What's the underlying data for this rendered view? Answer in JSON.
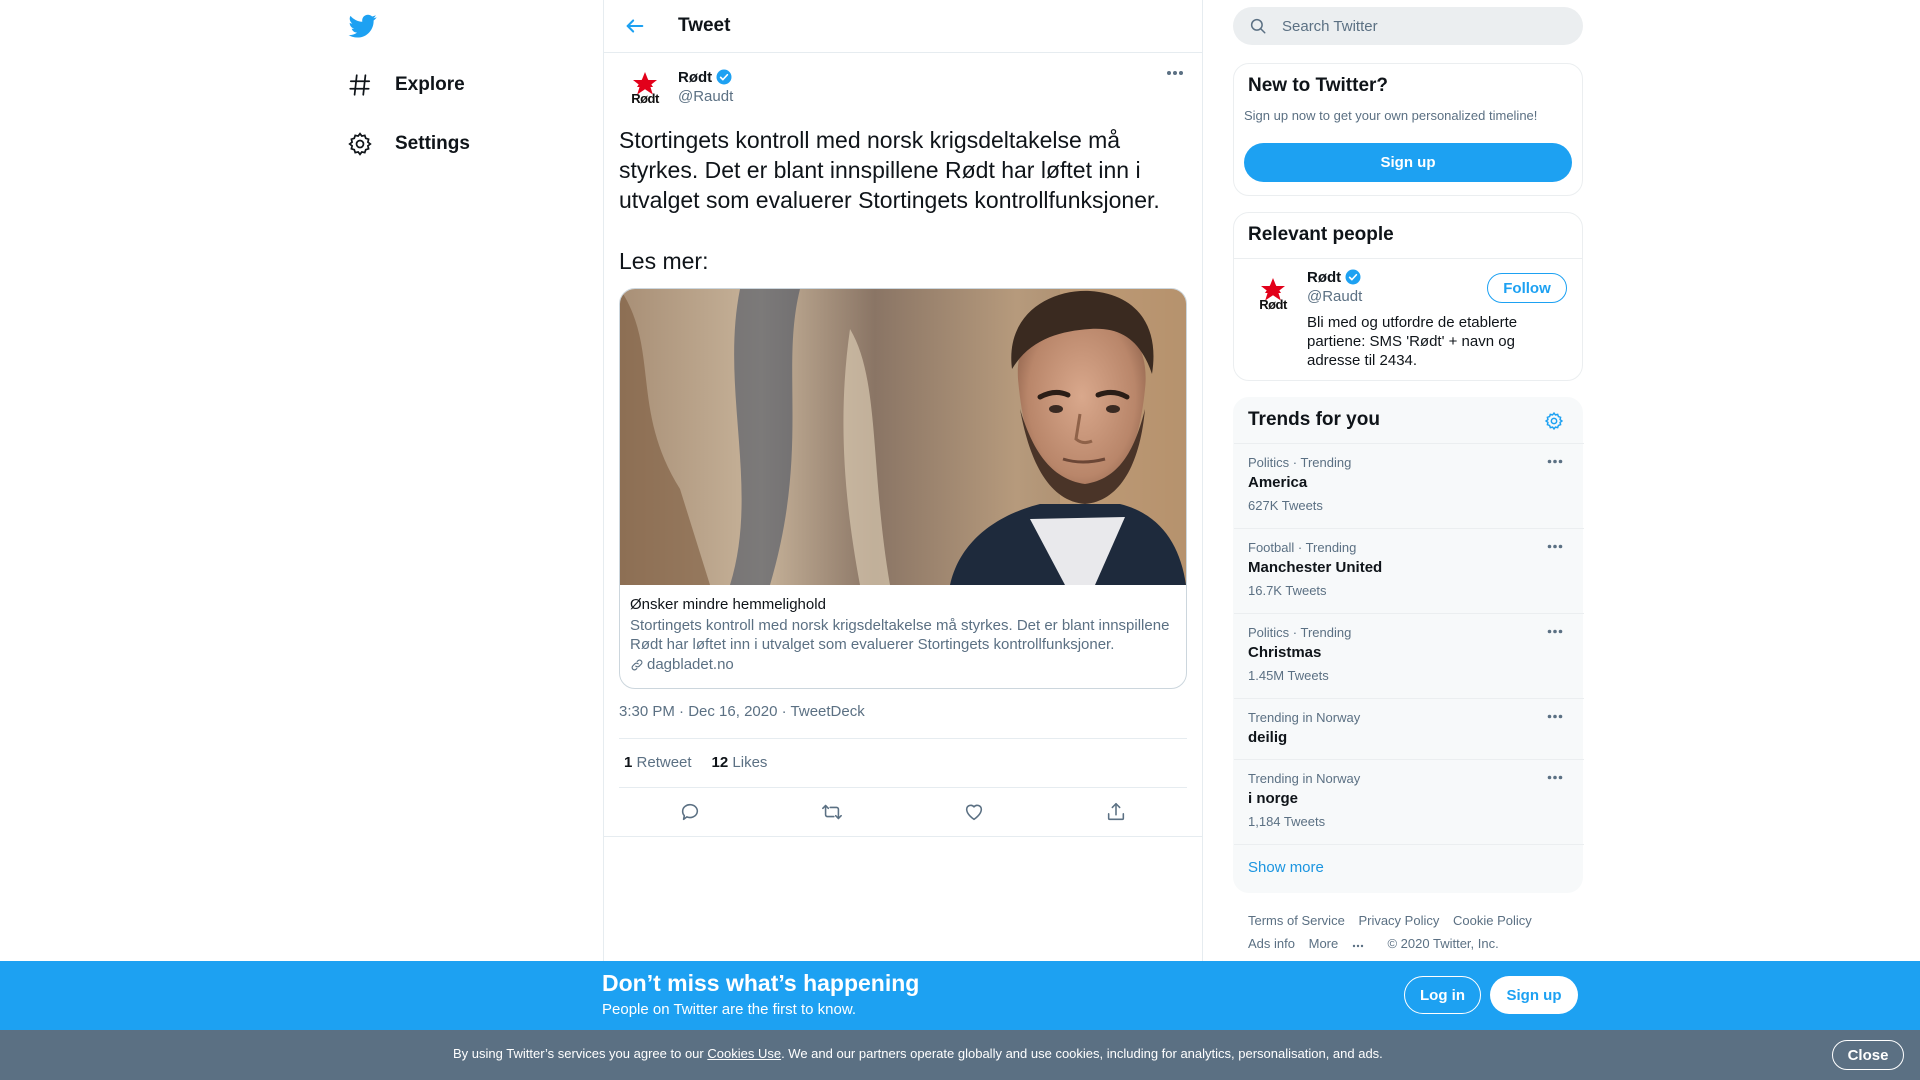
{
  "brand": {
    "accent": "#1da1f2",
    "accent_dark": "#1b95e0",
    "text_secondary": "#5b7083"
  },
  "nav": {
    "logo_icon": "twitter-bird-icon",
    "items": [
      {
        "label": "Explore",
        "icon": "hashtag-icon"
      },
      {
        "label": "Settings",
        "icon": "gear-icon"
      }
    ]
  },
  "header": {
    "title": "Tweet",
    "back_icon": "arrow-left-icon"
  },
  "tweet": {
    "author": {
      "name": "Rødt",
      "handle": "@Raudt",
      "verified": true,
      "avatar_text": "Rødt"
    },
    "text": "Stortingets kontroll med norsk krigsdeltakelse må styrkes. Det er blant innspillene Rødt har løftet inn i utvalget som evaluerer Stortingets kontrollfunksjoner.",
    "text2": "Les mer:",
    "card": {
      "title": "Ønsker mindre hemmelighold",
      "description": "Stortingets kontroll med norsk krigsdeltakelse må styrkes. Det er blant innspillene Rødt har løftet inn i utvalget som evaluerer Stortingets kontrollfunksjoner.",
      "domain": "dagbladet.no"
    },
    "time": "3:30 PM",
    "date": "Dec 16, 2020",
    "source": "TweetDeck",
    "sep": "·",
    "retweets": {
      "count": "1",
      "label": "Retweet"
    },
    "likes": {
      "count": "12",
      "label": "Likes"
    }
  },
  "search": {
    "placeholder": "Search Twitter"
  },
  "new_to_twitter": {
    "title": "New to Twitter?",
    "subtitle": "Sign up now to get your own personalized timeline!",
    "button": "Sign up"
  },
  "relevant_people": {
    "title": "Relevant people",
    "person": {
      "name": "Rødt",
      "handle": "@Raudt",
      "bio": "Bli med og utfordre de etablerte partiene: SMS 'Rødt' + navn og adresse til 2434.",
      "follow_label": "Follow"
    }
  },
  "trends": {
    "title": "Trends for you",
    "items": [
      {
        "category": "Politics · Trending",
        "name": "America",
        "count": "627K Tweets"
      },
      {
        "category": "Football · Trending",
        "name": "Manchester United",
        "count": "16.7K Tweets"
      },
      {
        "category": "Politics · Trending",
        "name": "Christmas",
        "count": "1.45M Tweets"
      },
      {
        "category": "Trending in Norway",
        "name": "deilig",
        "count": ""
      },
      {
        "category": "Trending in Norway",
        "name": "i norge",
        "count": "1,184 Tweets"
      }
    ],
    "show_more": "Show more"
  },
  "footer": {
    "terms": "Terms of Service",
    "privacy": "Privacy Policy",
    "cookie": "Cookie Policy",
    "ads": "Ads info",
    "more": "More",
    "copyright": "© 2020 Twitter, Inc."
  },
  "bottom_bar": {
    "title": "Don’t miss what’s happening",
    "subtitle": "People on Twitter are the first to know.",
    "login": "Log in",
    "signup": "Sign up"
  },
  "cookie_bar": {
    "text_before": "By using Twitter’s services you agree to our ",
    "link": "Cookies Use",
    "text_after": ". We and our partners operate globally and use cookies, including for analytics, personalisation, and ads.",
    "close": "Close"
  }
}
